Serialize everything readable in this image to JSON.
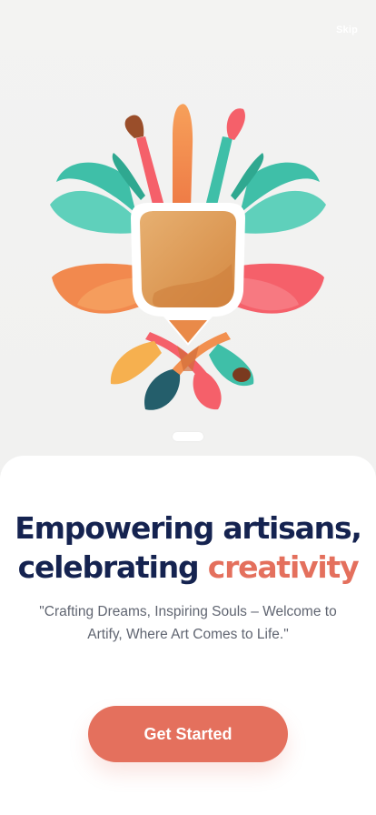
{
  "header": {
    "skip_label": "Skip"
  },
  "hero": {
    "illustration_icon": "artisan-brush-vase-logo"
  },
  "onboarding": {
    "title_line1": "Empowering artisans,",
    "title_line2_plain": "celebrating ",
    "title_line2_accent": "creativity",
    "subtitle": "\"Crafting Dreams, Inspiring Souls – Welcome to Artify, Where Art Comes to Life.\"",
    "cta_label": "Get Started",
    "page_index": 1,
    "page_count": 1
  },
  "colors": {
    "primary_navy": "#152350",
    "accent_coral": "#e4705d",
    "teal": "#3ec1a9",
    "orange": "#f2904f",
    "pink": "#f5606a",
    "gold": "#d8954f"
  }
}
